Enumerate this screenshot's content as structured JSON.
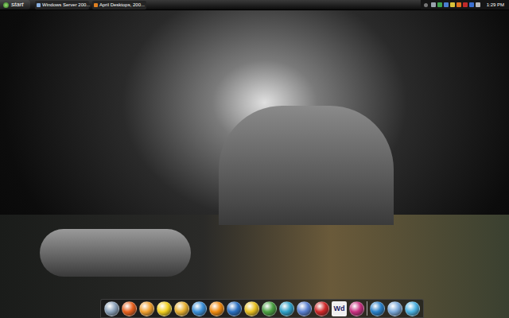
{
  "taskbar": {
    "start": "start",
    "buttons": [
      {
        "label": "Windows Server 200...",
        "selected": false
      },
      {
        "label": "April Desktops, 200...",
        "selected": false
      }
    ],
    "tray": [
      {
        "color": "#9aa3ad"
      },
      {
        "color": "#3fa34d"
      },
      {
        "color": "#4a7fd1"
      },
      {
        "color": "#d8c23a"
      },
      {
        "color": "#e07020"
      },
      {
        "color": "#c02a2a"
      },
      {
        "color": "#3a6fd0"
      },
      {
        "color": "#b8b8b8"
      }
    ],
    "clock": "1:29 PM"
  },
  "dock": {
    "items": [
      {
        "kind": "icon",
        "color": "#8aa0b8"
      },
      {
        "kind": "icon",
        "color": "#e8601c"
      },
      {
        "kind": "icon",
        "color": "#f0a030"
      },
      {
        "kind": "icon",
        "color": "#f2d020"
      },
      {
        "kind": "icon",
        "color": "#e8b030"
      },
      {
        "kind": "icon",
        "color": "#3a8fd8"
      },
      {
        "kind": "icon",
        "color": "#f08a10"
      },
      {
        "kind": "icon",
        "color": "#2a6fc0"
      },
      {
        "kind": "icon",
        "color": "#e8c020"
      },
      {
        "kind": "icon",
        "color": "#4aa040"
      },
      {
        "kind": "icon",
        "color": "#30a0c8"
      },
      {
        "kind": "icon",
        "color": "#5a80d0"
      },
      {
        "kind": "icon",
        "color": "#d02828"
      },
      {
        "kind": "text",
        "label": "Wd"
      },
      {
        "kind": "icon",
        "color": "#c83080"
      },
      {
        "kind": "separator"
      },
      {
        "kind": "icon",
        "color": "#2a80c8"
      },
      {
        "kind": "icon",
        "color": "#7aa8d8"
      },
      {
        "kind": "icon",
        "color": "#4ab0e0"
      }
    ]
  }
}
